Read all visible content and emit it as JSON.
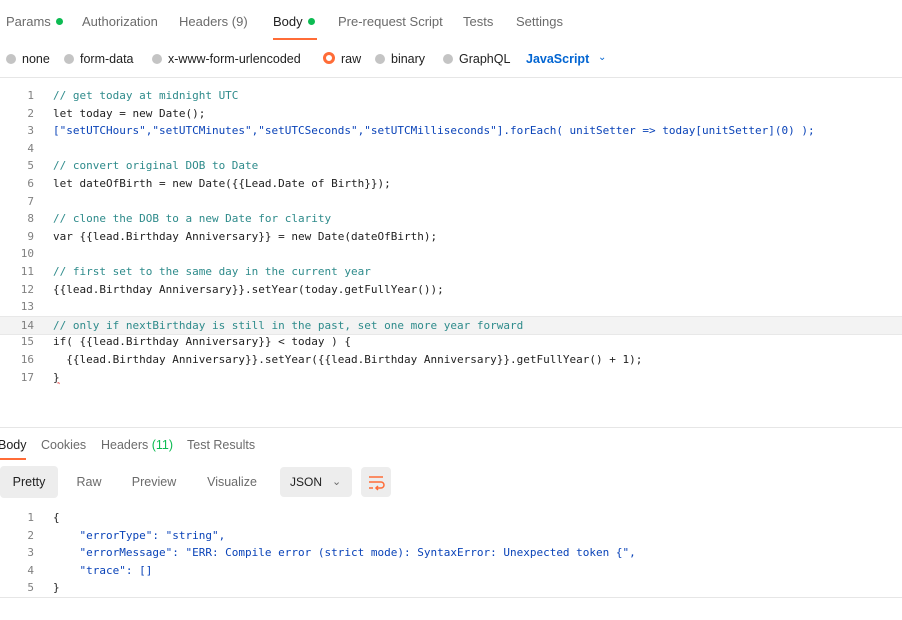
{
  "request_tabs": [
    {
      "label": "Params",
      "dot": true
    },
    {
      "label": "Authorization"
    },
    {
      "label": "Headers",
      "count": "(9)"
    },
    {
      "label": "Body",
      "dot": true,
      "active": true
    },
    {
      "label": "Pre-request Script"
    },
    {
      "label": "Tests"
    },
    {
      "label": "Settings"
    }
  ],
  "body_types": [
    "none",
    "form-data",
    "x-www-form-urlencoded",
    "raw",
    "binary",
    "GraphQL"
  ],
  "body_type_selected": "raw",
  "language": "JavaScript",
  "code_lines": [
    "// get today at midnight UTC",
    "let today = new Date();",
    "[\"setUTCHours\",\"setUTCMinutes\",\"setUTCSeconds\",\"setUTCMilliseconds\"].forEach( unitSetter => today[unitSetter](0) );",
    "",
    "// convert original DOB to Date",
    "let dateOfBirth = new Date({{Lead.Date of Birth}});",
    "",
    "// clone the DOB to a new Date for clarity",
    "var {{lead.Birthday Anniversary}} = new Date(dateOfBirth);",
    "",
    "// first set to the same day in the current year",
    "{{lead.Birthday Anniversary}}.setYear(today.getFullYear());",
    "",
    "// only if nextBirthday is still in the past, set one more year forward",
    "if( {{lead.Birthday Anniversary}} < today ) {",
    "  {{lead.Birthday Anniversary}}.setYear({{lead.Birthday Anniversary}}.getFullYear() + 1);",
    "}"
  ],
  "line_numbers": [
    "1",
    "2",
    "3",
    "4",
    "5",
    "6",
    "7",
    "8",
    "9",
    "10",
    "11",
    "12",
    "13",
    "14",
    "15",
    "16",
    "17"
  ],
  "response_tabs": [
    {
      "label": "Body",
      "active": true
    },
    {
      "label": "Cookies"
    },
    {
      "label": "Headers",
      "count": "(11)"
    },
    {
      "label": "Test Results"
    }
  ],
  "view_modes": [
    "Pretty",
    "Raw",
    "Preview",
    "Visualize"
  ],
  "view_selected": "Pretty",
  "format": "JSON",
  "response_lines": [
    "{",
    "    \"errorType\": \"string\",",
    "    \"errorMessage\": \"ERR: Compile error (strict mode): SyntaxError: Unexpected token {\",",
    "    \"trace\": []",
    "}"
  ],
  "response_line_numbers": [
    "1",
    "2",
    "3",
    "4",
    "5"
  ],
  "colors": {
    "accent": "#ff6c37",
    "active_dot": "#0cbb52",
    "link": "#0265d2"
  }
}
